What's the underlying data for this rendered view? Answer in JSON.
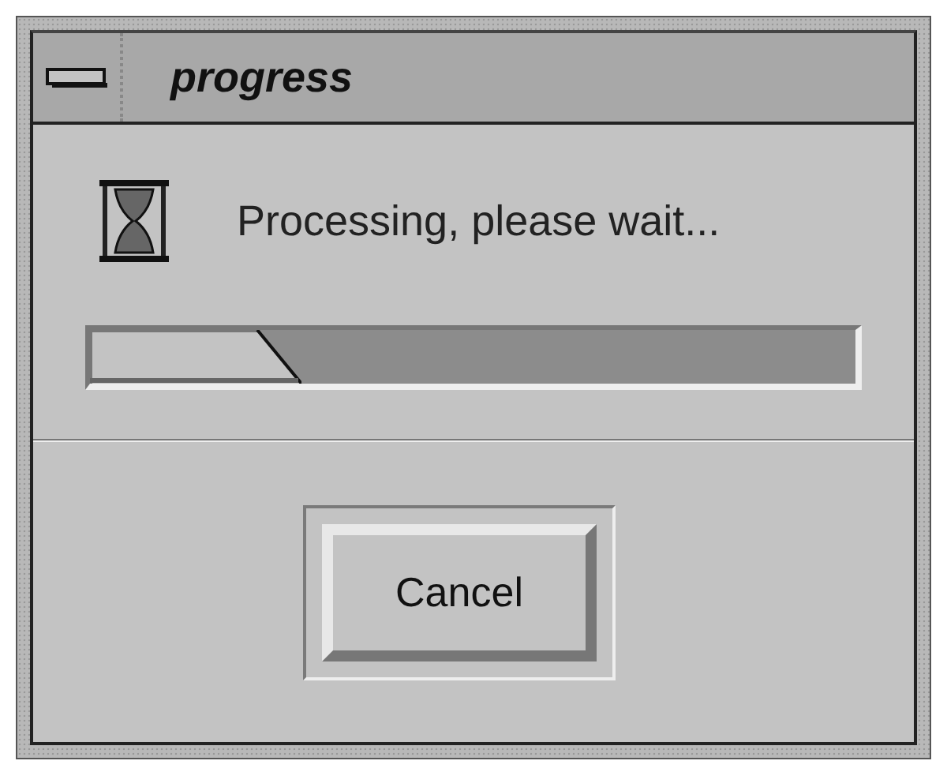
{
  "window": {
    "title": "progress"
  },
  "message": "Processing, please wait...",
  "progress": {
    "level": 0.22
  },
  "buttons": [
    {
      "label": "Cancel",
      "default": true
    }
  ]
}
